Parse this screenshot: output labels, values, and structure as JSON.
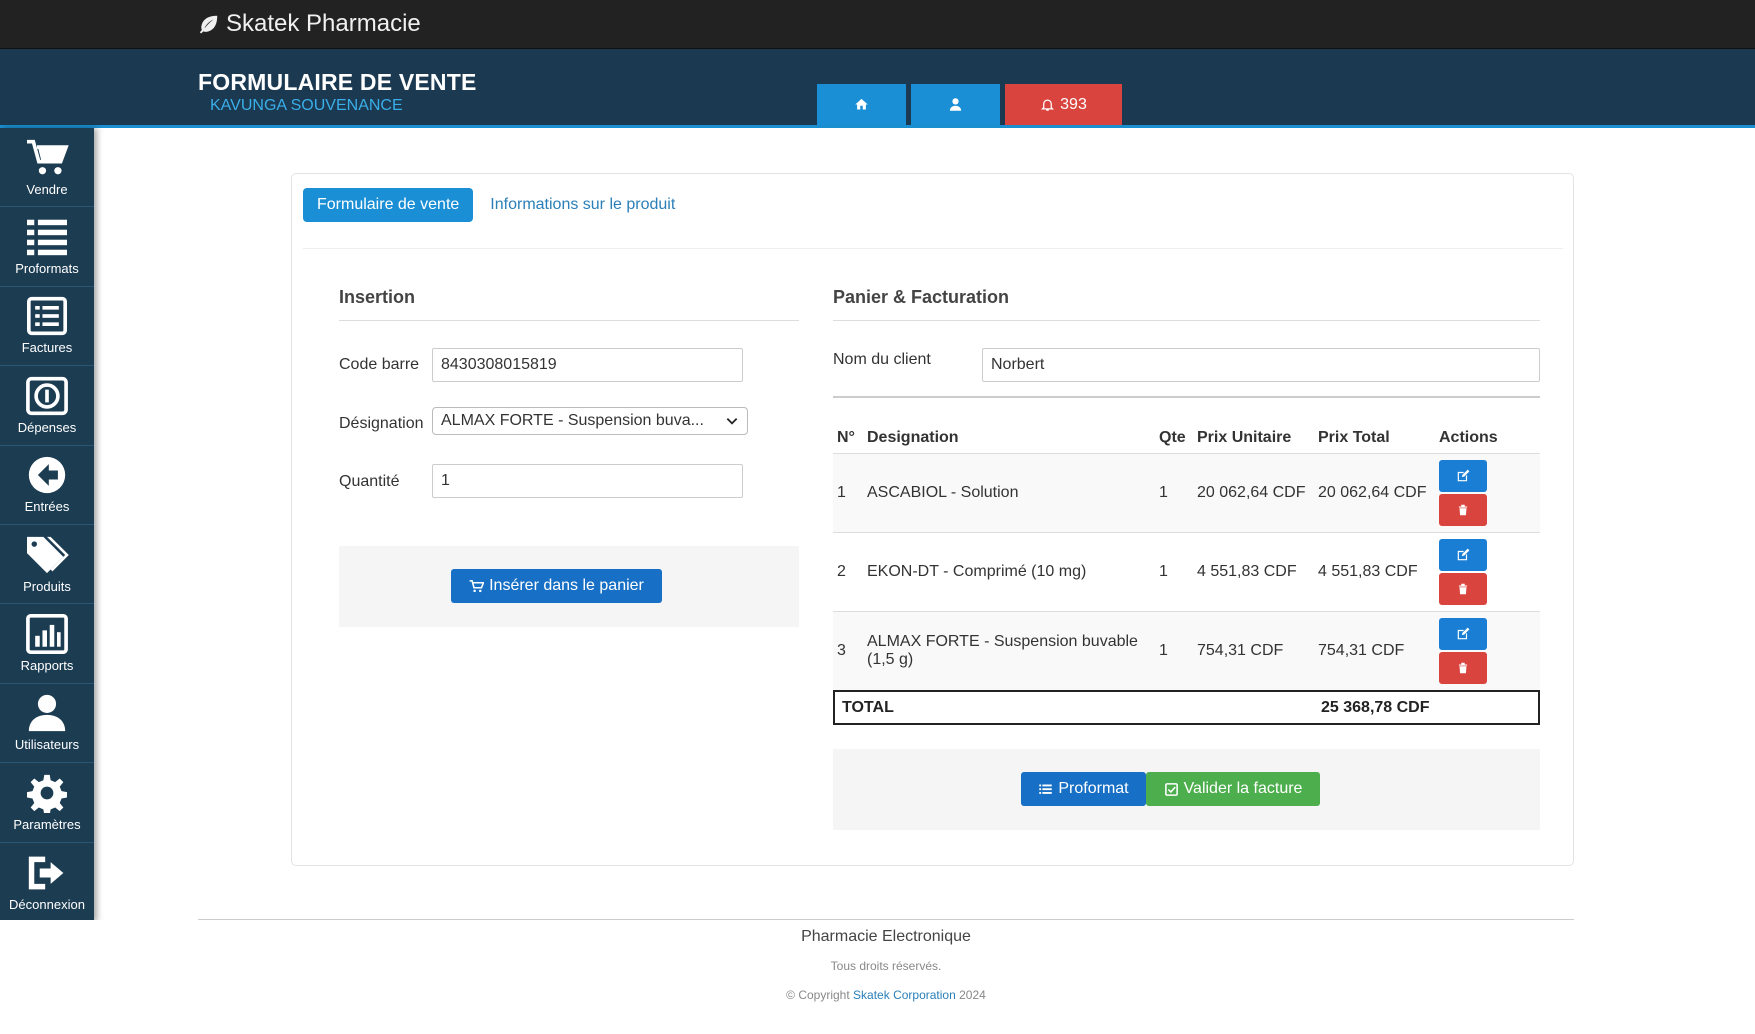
{
  "app": {
    "brand": "Skatek Pharmacie"
  },
  "header": {
    "title": "FORMULAIRE DE VENTE",
    "subtitle": "KAVUNGA SOUVENANCE",
    "notifications_count": "393"
  },
  "sidebar": {
    "items": [
      {
        "label": "Vendre",
        "icon": "cart-icon"
      },
      {
        "label": "Proformats",
        "icon": "list-icon"
      },
      {
        "label": "Factures",
        "icon": "invoice-icon"
      },
      {
        "label": "Dépenses",
        "icon": "money-icon"
      },
      {
        "label": "Entrées",
        "icon": "arrow-left-circle-icon"
      },
      {
        "label": "Produits",
        "icon": "tags-icon"
      },
      {
        "label": "Rapports",
        "icon": "bar-chart-icon"
      },
      {
        "label": "Utilisateurs",
        "icon": "user-icon"
      },
      {
        "label": "Paramètres",
        "icon": "gear-icon"
      },
      {
        "label": "Déconnexion",
        "icon": "sign-out-icon"
      }
    ]
  },
  "tabs": {
    "active": "Formulaire de vente",
    "other": "Informations sur le produit"
  },
  "insertion": {
    "title": "Insertion",
    "barcode_label": "Code barre",
    "barcode_value": "8430308015819",
    "designation_label": "Désignation",
    "designation_value": "ALMAX FORTE - Suspension buva...",
    "quantity_label": "Quantité",
    "quantity_value": "1",
    "insert_button": "Insérer dans le panier"
  },
  "cart": {
    "title": "Panier & Facturation",
    "client_label": "Nom du client",
    "client_value": "Norbert",
    "columns": [
      "N°",
      "Designation",
      "Qte",
      "Prix Unitaire",
      "Prix Total",
      "Actions"
    ],
    "rows": [
      {
        "n": "1",
        "designation": "ASCABIOL - Solution",
        "qte": "1",
        "pu": "20 062,64 CDF",
        "pt": "20 062,64 CDF"
      },
      {
        "n": "2",
        "designation": "EKON-DT - Comprimé (10 mg)",
        "qte": "1",
        "pu": "4 551,83 CDF",
        "pt": "4 551,83 CDF"
      },
      {
        "n": "3",
        "designation": "ALMAX FORTE - Suspension buvable (1,5 g)",
        "qte": "1",
        "pu": "754,31 CDF",
        "pt": "754,31 CDF"
      }
    ],
    "total_label": "TOTAL",
    "total_value": "25 368,78 CDF",
    "proformat_button": "Proformat",
    "validate_button": "Valider la facture"
  },
  "footer": {
    "title": "Pharmacie Electronique",
    "rights": "Tous droits réservés.",
    "copyright_prefix": "© Copyright",
    "company": "Skatek Corporation",
    "year": "2024"
  },
  "colors": {
    "topbar": "#222222",
    "header": "#1b3a52",
    "accent": "#1a8fd6",
    "danger": "#d9443f",
    "success": "#4cae4c"
  }
}
